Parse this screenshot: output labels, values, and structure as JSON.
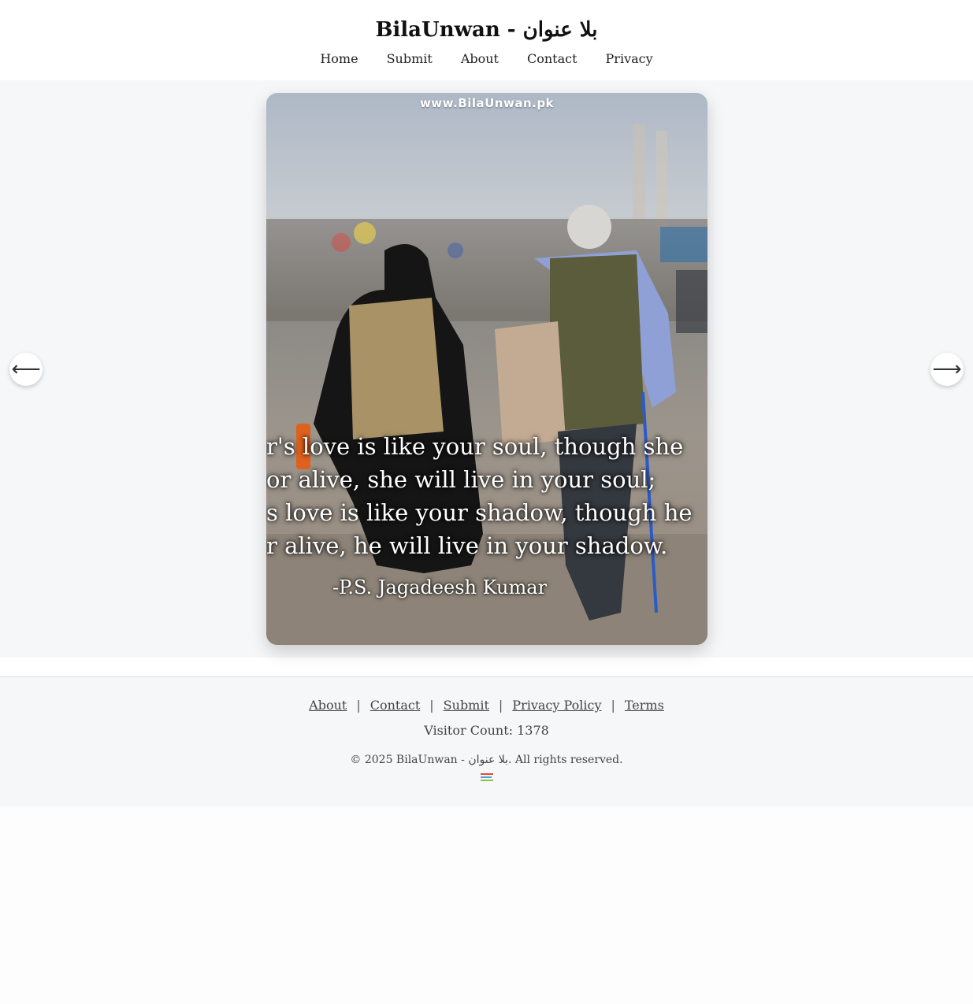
{
  "header": {
    "site_title": "BilaUnwan - بلا عنوان",
    "nav": [
      {
        "label": "Home"
      },
      {
        "label": "Submit"
      },
      {
        "label": "About"
      },
      {
        "label": "Contact"
      },
      {
        "label": "Privacy"
      }
    ]
  },
  "slideshow": {
    "watermark": "www.BilaUnwan.pk",
    "quote_lines": [
      "r's love is like your soul, though she",
      "or alive, she will live in your soul;",
      "s love is like your shadow, though he",
      "r alive, he will live in your shadow."
    ],
    "quote_author": "-P.S. Jagadeesh Kumar",
    "prev_label": "⟵",
    "next_label": "⟶"
  },
  "footer": {
    "links": [
      {
        "label": "About"
      },
      {
        "label": "Contact"
      },
      {
        "label": "Submit"
      },
      {
        "label": "Privacy Policy"
      },
      {
        "label": "Terms"
      }
    ],
    "separator": "|",
    "visitor_count": "Visitor Count: 1378",
    "copyright": "© 2025 BilaUnwan - بلا عنوان. All rights reserved."
  },
  "colors": {
    "page_background": "#f6f7f9",
    "header_background": "#ffffff",
    "text": "#222222"
  }
}
